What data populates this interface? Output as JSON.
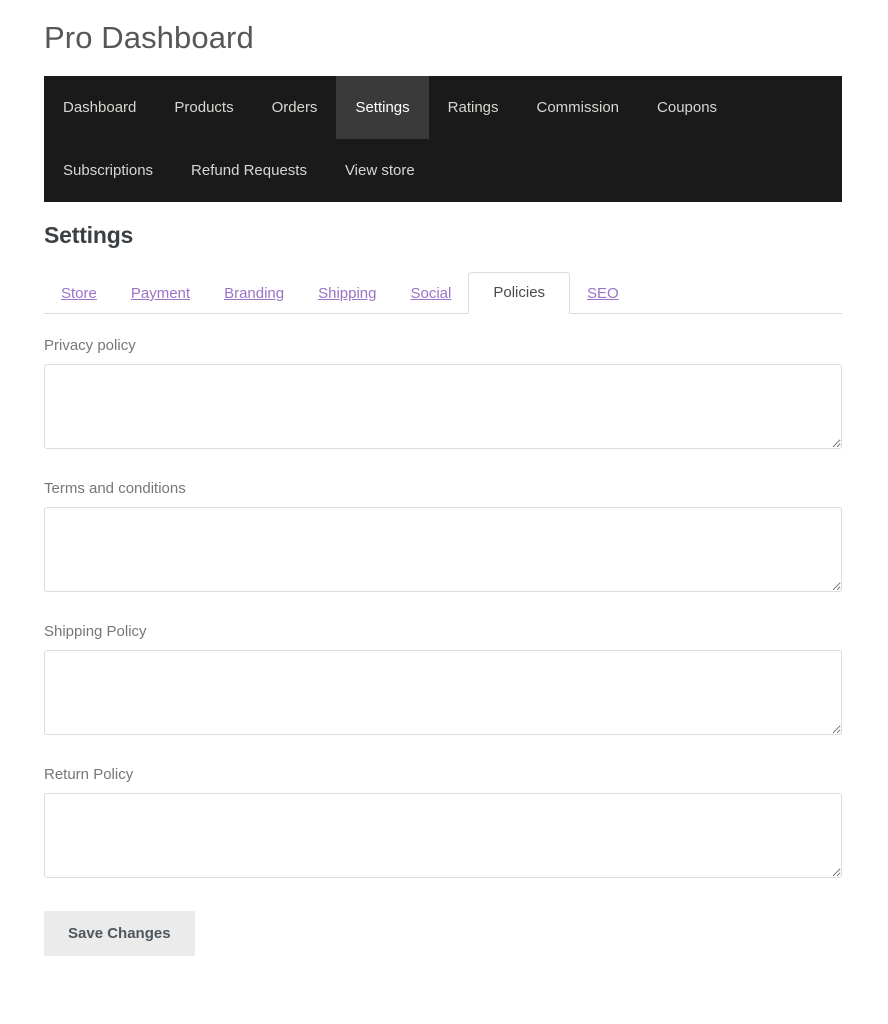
{
  "page": {
    "title": "Pro Dashboard"
  },
  "main_nav": {
    "active": "Settings",
    "rows": [
      [
        {
          "label": "Dashboard",
          "active": false
        },
        {
          "label": "Products",
          "active": false
        },
        {
          "label": "Orders",
          "active": false
        },
        {
          "label": "Settings",
          "active": true
        },
        {
          "label": "Ratings",
          "active": false
        },
        {
          "label": "Commission",
          "active": false
        },
        {
          "label": "Coupons",
          "active": false
        }
      ],
      [
        {
          "label": "Subscriptions",
          "active": false
        },
        {
          "label": "Refund Requests",
          "active": false
        },
        {
          "label": "View store",
          "active": false
        }
      ]
    ]
  },
  "section": {
    "heading": "Settings"
  },
  "tabs": {
    "active": "Policies",
    "items": [
      {
        "label": "Store",
        "active": false
      },
      {
        "label": "Payment",
        "active": false
      },
      {
        "label": "Branding",
        "active": false
      },
      {
        "label": "Shipping",
        "active": false
      },
      {
        "label": "Social",
        "active": false
      },
      {
        "label": "Policies",
        "active": true
      },
      {
        "label": "SEO",
        "active": false
      }
    ]
  },
  "form": {
    "fields": [
      {
        "label": "Privacy policy",
        "value": "",
        "placeholder": ""
      },
      {
        "label": "Terms and conditions",
        "value": "",
        "placeholder": ""
      },
      {
        "label": "Shipping Policy",
        "value": "",
        "placeholder": ""
      },
      {
        "label": "Return Policy",
        "value": "",
        "placeholder": ""
      }
    ],
    "save_label": "Save Changes"
  },
  "colors": {
    "nav_background": "#1a1a1a",
    "nav_active_background": "#3a3a3a",
    "nav_text": "#d8d6d2",
    "tab_link": "#9a73c7",
    "tab_active_text": "#4b4b4b",
    "heading": "#3a3f44",
    "page_title": "#575757",
    "label": "#777777",
    "field_border": "#dcdcdc",
    "button_background": "#ebebeb",
    "button_text": "#4e565e"
  }
}
